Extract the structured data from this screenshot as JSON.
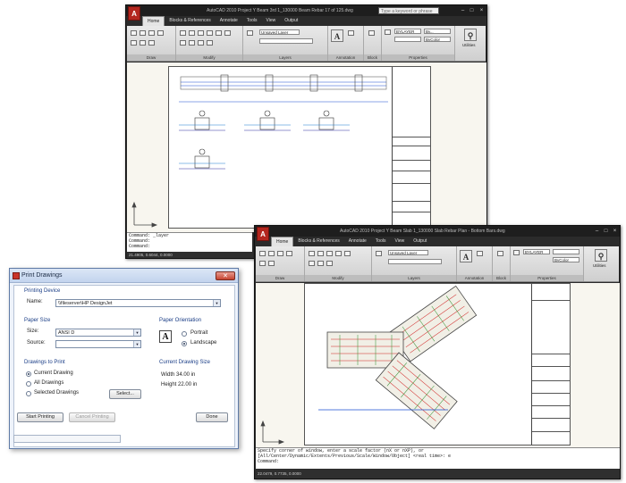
{
  "top_window": {
    "title": "AutoCAD 2010 Project Y Beam 3rd 1_130000 Beam Rebar 17 of 125.dwg",
    "search_placeholder": "Type a keyword or phrase",
    "tabs": [
      "Home",
      "Blocks & References",
      "Annotate",
      "Tools",
      "View",
      "Output"
    ],
    "panels": [
      "Draw",
      "Modify",
      "Layers",
      "Annotation",
      "Block",
      "Properties",
      "Utilities"
    ],
    "layer_value": "Unsaved Layer",
    "bylayer_value": "BYLAYER",
    "bycolor_value": "ByColor",
    "by_value": "By...",
    "command_lines": [
      "Command: _layer",
      "Command:",
      "Command:"
    ],
    "coords": "21.4905, 0.6044, 0.0000"
  },
  "bottom_window": {
    "title": "AutoCAD 2010 Project Y Beam Slab 1_130000 Slab Rebar Plan - Bottom Bars.dwg",
    "tabs": [
      "Home",
      "Blocks & References",
      "Annotate",
      "Tools",
      "View",
      "Output"
    ],
    "panels": [
      "Draw",
      "Modify",
      "Layers",
      "Annotation",
      "Block",
      "Properties",
      "Utilities"
    ],
    "layer_value": "Unsaved Layer",
    "bylayer_value": "BYLAYER",
    "bycolor_value": "ByColor",
    "command_lines": [
      "Specify corner of window, enter a scale factor (nX or nXP), or",
      "[All/Center/Dynamic/Extents/Previous/Scale/Window/Object] <real time>: e",
      "Command:"
    ],
    "coords": "22.0479, 0.7735, 0.0000"
  },
  "print_dialog": {
    "title": "Print Drawings",
    "printing_device": {
      "section": "Printing Device",
      "name_label": "Name:",
      "name_value": "\\\\fileserver\\HP DesignJet"
    },
    "paper_size": {
      "section": "Paper Size",
      "size_label": "Size:",
      "size_value": "ANSI D",
      "source_label": "Source:",
      "source_value": ""
    },
    "paper_orientation": {
      "section": "Paper Orientation",
      "icon_glyph": "A",
      "portrait": "Portrait",
      "landscape": "Landscape",
      "selected": "Landscape"
    },
    "drawings_to_print": {
      "section": "Drawings to Print",
      "current": "Current Drawing",
      "all": "All Drawings",
      "selected": "Selected Drawings",
      "select_button": "Select...",
      "selected_option": "Current Drawing"
    },
    "current_drawing_size": {
      "section": "Current Drawing Size",
      "width": "Width 34.00 in",
      "height": "Height 22.00 in"
    },
    "buttons": {
      "start": "Start Printing",
      "cancel": "Cancel Printing",
      "done": "Done"
    },
    "close_glyph": "✕"
  },
  "colors": {
    "cad_frame": "#2b2b2b",
    "cad_logo": "#b3261e",
    "drawing_bg": "#f8f6ef",
    "dialog_section": "#1a3d86",
    "rebar_red": "#d02020",
    "rebar_green": "#2f8f2f"
  },
  "icons": [
    "autocad-logo-icon",
    "minimize-icon",
    "maximize-icon",
    "close-icon",
    "orientation-a-icon",
    "dropdown-arrow-icon",
    "ucs-axis-icon"
  ]
}
